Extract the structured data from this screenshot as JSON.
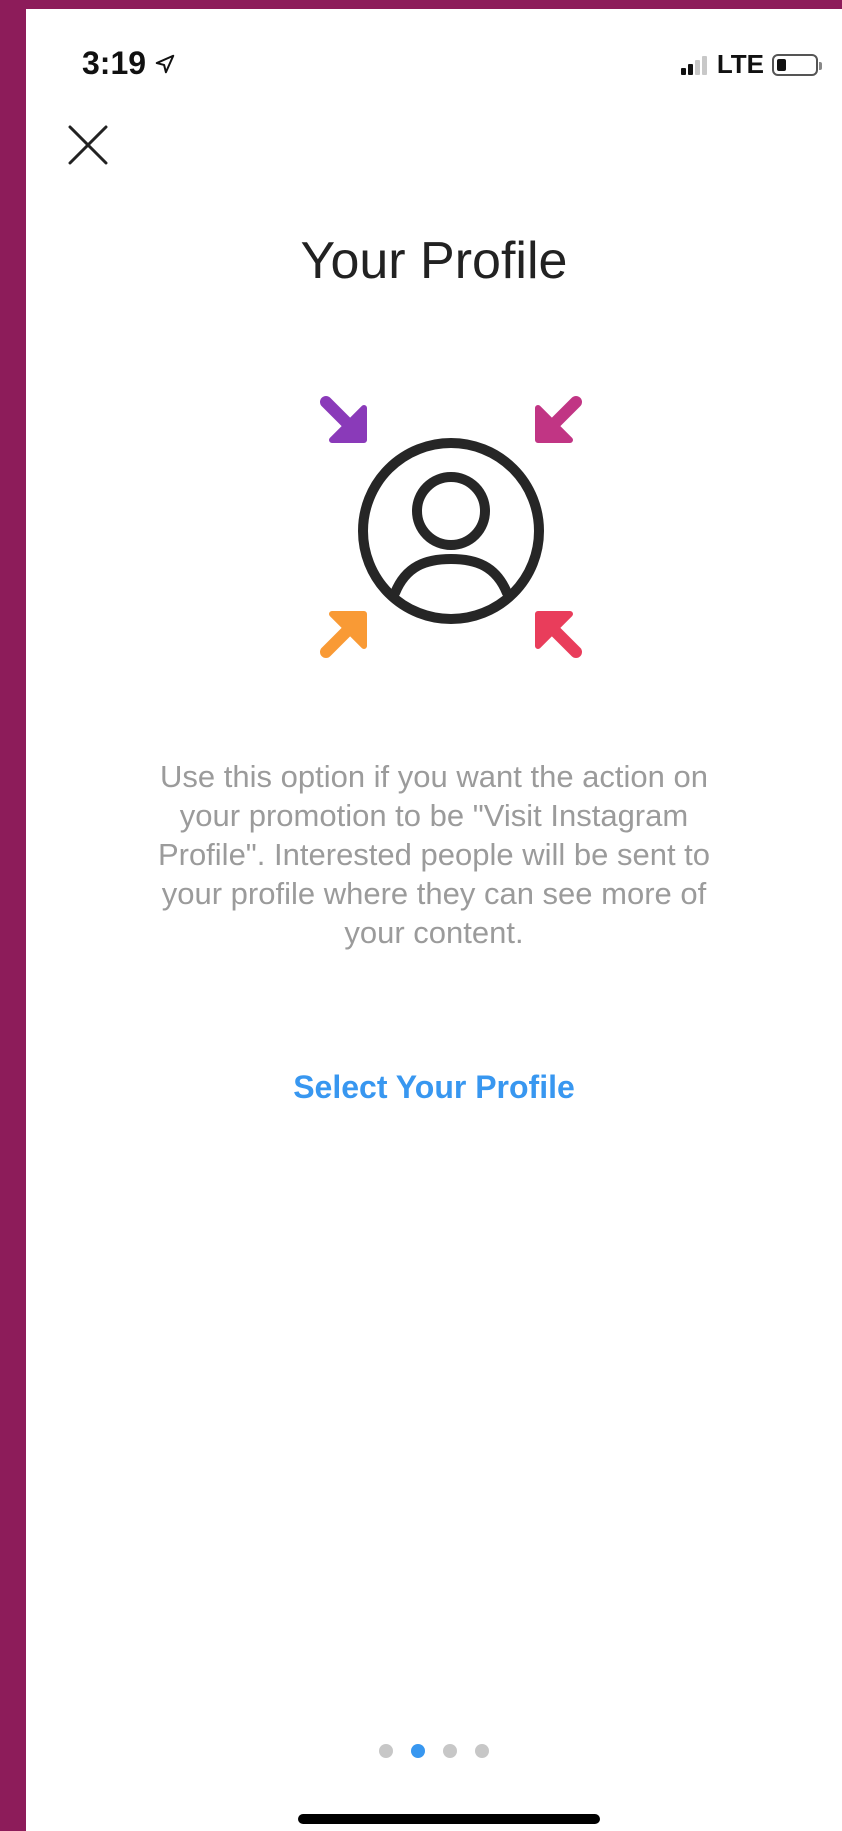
{
  "status_bar": {
    "time": "3:19",
    "network": "LTE",
    "signal_bars_filled": 2,
    "signal_bars_total": 4,
    "battery_level": 0.25
  },
  "header": {
    "close_icon": "close-icon"
  },
  "main": {
    "title": "Your Profile",
    "illustration_icon": "profile-target-icon",
    "description": "Use this option if you want the action on your promotion to be \"Visit Instagram Profile\". Interested people will be sent to your profile where they can see more of your content.",
    "action_label": "Select Your Profile"
  },
  "pagination": {
    "total": 4,
    "active_index": 1
  },
  "colors": {
    "accent": "#3897f0",
    "frame": "#8d1c5a",
    "arrow_purple": "#8a3ab9",
    "arrow_magenta": "#c13584",
    "arrow_orange": "#f99a35",
    "arrow_red": "#e93d5b"
  }
}
